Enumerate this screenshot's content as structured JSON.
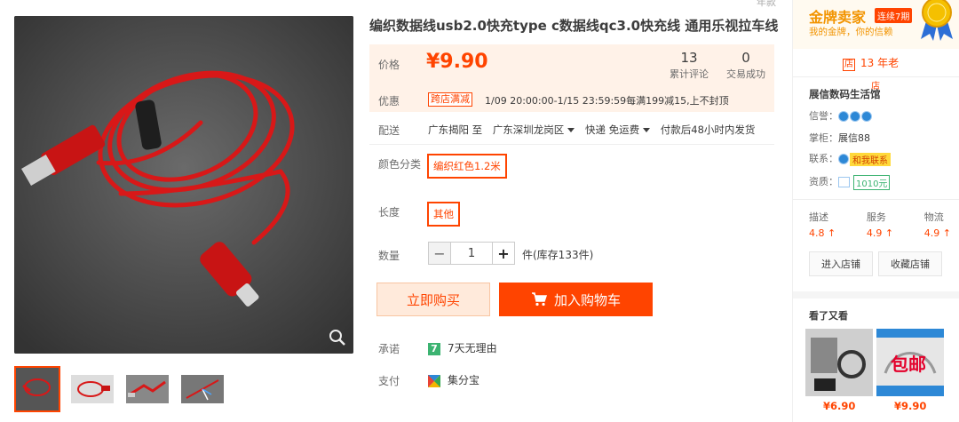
{
  "product": {
    "title": "编织数据线usb2.0快充type c数据线qc3.0快充线 通用乐视拉车线",
    "title_cutoff": "年款",
    "price_label": "价格",
    "price": "¥9.90",
    "reviews_count": "13",
    "reviews_label": "累计评论",
    "deals_count": "0",
    "deals_label": "交易成功"
  },
  "promo": {
    "label": "优惠",
    "tag": "跨店满减",
    "text": "1/09 20:00:00-1/15 23:59:59每满199减15,上不封顶"
  },
  "shipping": {
    "label": "配送",
    "from": "广东揭阳 至",
    "to": "广东深圳龙岗区",
    "express": "快递 免运费",
    "note": "付款后48小时内发货"
  },
  "options": {
    "color_label": "颜色分类",
    "color_value": "编织红色1.2米",
    "length_label": "长度",
    "length_value": "其他"
  },
  "quantity": {
    "label": "数量",
    "minus": "−",
    "value": "1",
    "plus": "+",
    "stock": "件(库存133件)"
  },
  "actions": {
    "buy_now": "立即购买",
    "add_cart": "加入购物车"
  },
  "promise": {
    "label": "承诺",
    "badge": "7",
    "text": "7天无理由"
  },
  "payment": {
    "label": "支付",
    "text": "集分宝"
  },
  "seller": {
    "gold_title": "金牌卖家",
    "streak": "连续7期",
    "slogan": "我的金牌，你的信赖",
    "years_icon": "店",
    "years": "13 年老",
    "years_overflow": "店",
    "shop_name": "展信数码生活馆",
    "credit_label": "信誉：",
    "keeper_label": "掌柜：",
    "keeper": "展信88",
    "contact_label": "联系：",
    "contact_btn": "和我联系",
    "qual_label": "资质：",
    "deposit": "1010元",
    "scores": [
      {
        "label": "描述",
        "value": "4.8 ↑"
      },
      {
        "label": "服务",
        "value": "4.9 ↑"
      },
      {
        "label": "物流",
        "value": "4.9 ↑"
      }
    ],
    "enter_shop": "进入店铺",
    "fav_shop": "收藏店铺"
  },
  "recommend": {
    "title": "看了又看",
    "items": [
      {
        "price": "¥6.90"
      },
      {
        "price": "¥9.90",
        "overlay": "包邮"
      }
    ]
  },
  "colors": {
    "accent": "#ff4400",
    "price_bg": "#fff2e8"
  }
}
